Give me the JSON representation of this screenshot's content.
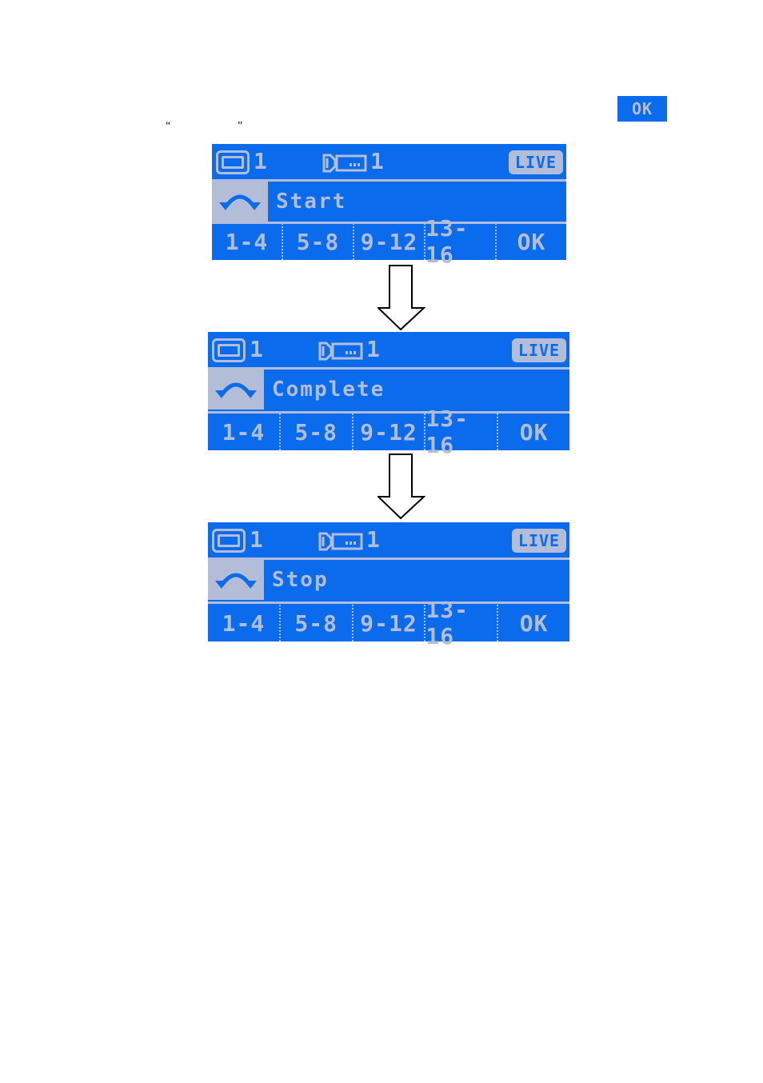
{
  "intro": {
    "ok_key_label": "OK",
    "open_quote": "“",
    "close_quote": "”"
  },
  "colors": {
    "screen_bg": "#0a6ced",
    "screen_fg": "#b4bdd8"
  },
  "panels": [
    {
      "status": {
        "monitor_icon": "monitor-icon",
        "monitor_number": "1",
        "camera_icon": "camera-icon",
        "camera_number": "1",
        "live_label": "LIVE"
      },
      "message": {
        "icon": "tour-arc-arrows-icon",
        "text": "Start"
      },
      "buttons": [
        "1-4",
        "5-8",
        "9-12",
        "13-16",
        "OK"
      ]
    },
    {
      "status": {
        "monitor_icon": "monitor-icon",
        "monitor_number": "1",
        "camera_icon": "camera-icon",
        "camera_number": "1",
        "live_label": "LIVE"
      },
      "message": {
        "icon": "tour-arc-arrows-icon",
        "text": "Complete"
      },
      "buttons": [
        "1-4",
        "5-8",
        "9-12",
        "13-16",
        "OK"
      ]
    },
    {
      "status": {
        "monitor_icon": "monitor-icon",
        "monitor_number": "1",
        "camera_icon": "camera-icon",
        "camera_number": "1",
        "live_label": "LIVE"
      },
      "message": {
        "icon": "tour-arc-arrows-icon",
        "text": "Stop"
      },
      "buttons": [
        "1-4",
        "5-8",
        "9-12",
        "13-16",
        "OK"
      ]
    }
  ],
  "flow_arrows": [
    "down-arrow-icon",
    "down-arrow-icon"
  ]
}
